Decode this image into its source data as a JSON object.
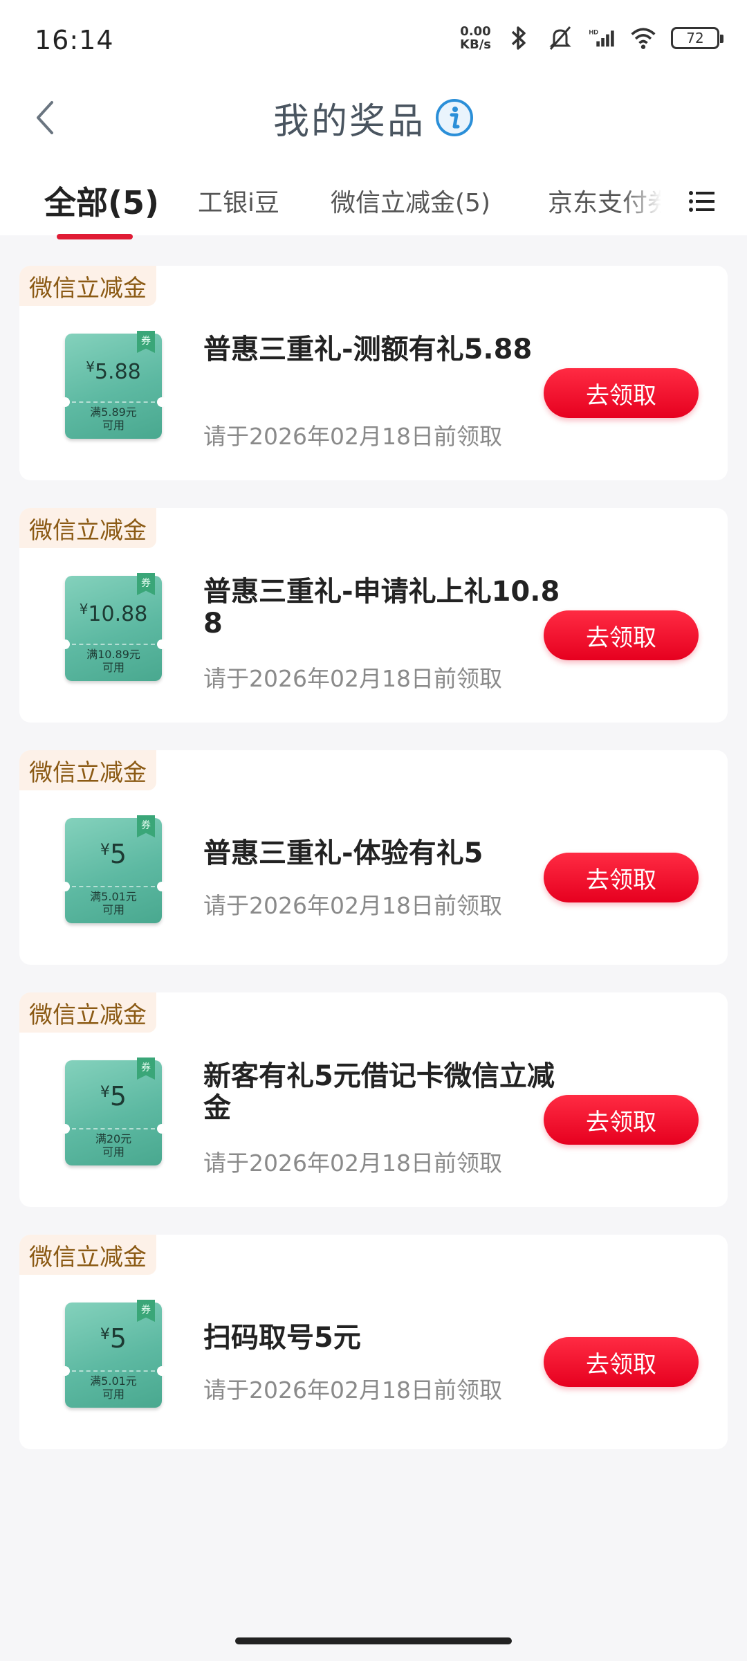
{
  "status_bar": {
    "time": "16:14",
    "net_speed_value": "0.00",
    "net_speed_unit": "KB/s",
    "battery": "72",
    "icons": [
      "bluetooth-icon",
      "bell-muted-icon",
      "hd-signal-icon",
      "wifi-icon"
    ]
  },
  "header": {
    "title": "我的奖品",
    "back_icon": "chevron-left-icon",
    "info_icon": "info-icon"
  },
  "tabs": [
    {
      "label": "全部(5)",
      "active": true
    },
    {
      "label": "工银i豆",
      "active": false
    },
    {
      "label": "微信立减金(5)",
      "active": false
    },
    {
      "label": "京东支付券",
      "active": false
    }
  ],
  "menu_icon": "list-menu-icon",
  "colors": {
    "accent_red": "#e01c35",
    "button_red": "#ff1f3a",
    "coupon_green": "#5db9a2",
    "tag_bg": "#fdf1e8",
    "tag_text": "#8b5a14"
  },
  "prizes": [
    {
      "tag": "微信立减金",
      "coupon_symbol": "¥",
      "coupon_amount": "5.88",
      "coupon_condition_line1": "满5.89元",
      "coupon_condition_line2": "可用",
      "ribbon": "券",
      "title": "普惠三重礼-测额有礼5.88",
      "deadline": "请于2026年02月18日前领取",
      "button": "去领取"
    },
    {
      "tag": "微信立减金",
      "coupon_symbol": "¥",
      "coupon_amount": "10.88",
      "coupon_condition_line1": "满10.89元",
      "coupon_condition_line2": "可用",
      "ribbon": "券",
      "title": "普惠三重礼-申请礼上礼10.88",
      "deadline": "请于2026年02月18日前领取",
      "button": "去领取"
    },
    {
      "tag": "微信立减金",
      "coupon_symbol": "¥",
      "coupon_amount": "5",
      "coupon_condition_line1": "满5.01元",
      "coupon_condition_line2": "可用",
      "ribbon": "券",
      "title": "普惠三重礼-体验有礼5",
      "deadline": "请于2026年02月18日前领取",
      "button": "去领取"
    },
    {
      "tag": "微信立减金",
      "coupon_symbol": "¥",
      "coupon_amount": "5",
      "coupon_condition_line1": "满20元",
      "coupon_condition_line2": "可用",
      "ribbon": "券",
      "title": "新客有礼5元借记卡微信立减金",
      "deadline": "请于2026年02月18日前领取",
      "button": "去领取"
    },
    {
      "tag": "微信立减金",
      "coupon_symbol": "¥",
      "coupon_amount": "5",
      "coupon_condition_line1": "满5.01元",
      "coupon_condition_line2": "可用",
      "ribbon": "券",
      "title": "扫码取号5元",
      "deadline": "请于2026年02月18日前领取",
      "button": "去领取"
    }
  ]
}
